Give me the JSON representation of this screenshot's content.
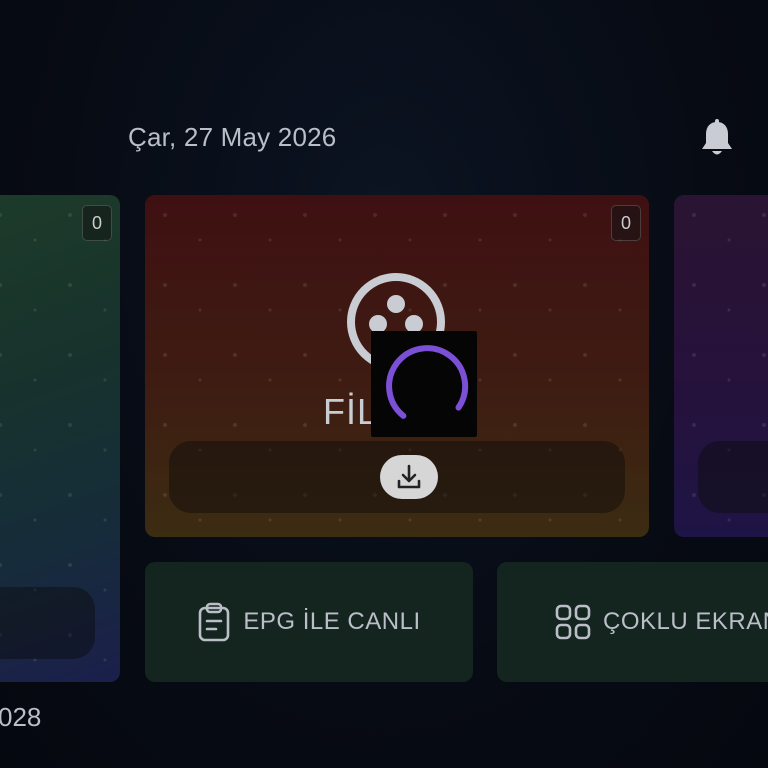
{
  "header": {
    "date": "Çar, 27 May 2026",
    "notification_icon": "bell-icon"
  },
  "cards": {
    "left": {
      "count": "0"
    },
    "center": {
      "count": "0",
      "title": "FİL",
      "icon": "film-reel-icon"
    },
    "right": {}
  },
  "overlay": {
    "loading_icon": "spinner-icon",
    "accent": "#7b4fd6",
    "download_icon": "download-icon"
  },
  "tiles": {
    "epg": {
      "label": "EPG İLE CANLI",
      "icon": "clipboard-icon"
    },
    "multi": {
      "label": "ÇOKLU EKRAN",
      "icon": "grid-icon"
    }
  },
  "footer": {
    "number": "028"
  },
  "colors": {
    "background": "#060a12",
    "text": "#b9bec7",
    "tile": "#14241f"
  }
}
